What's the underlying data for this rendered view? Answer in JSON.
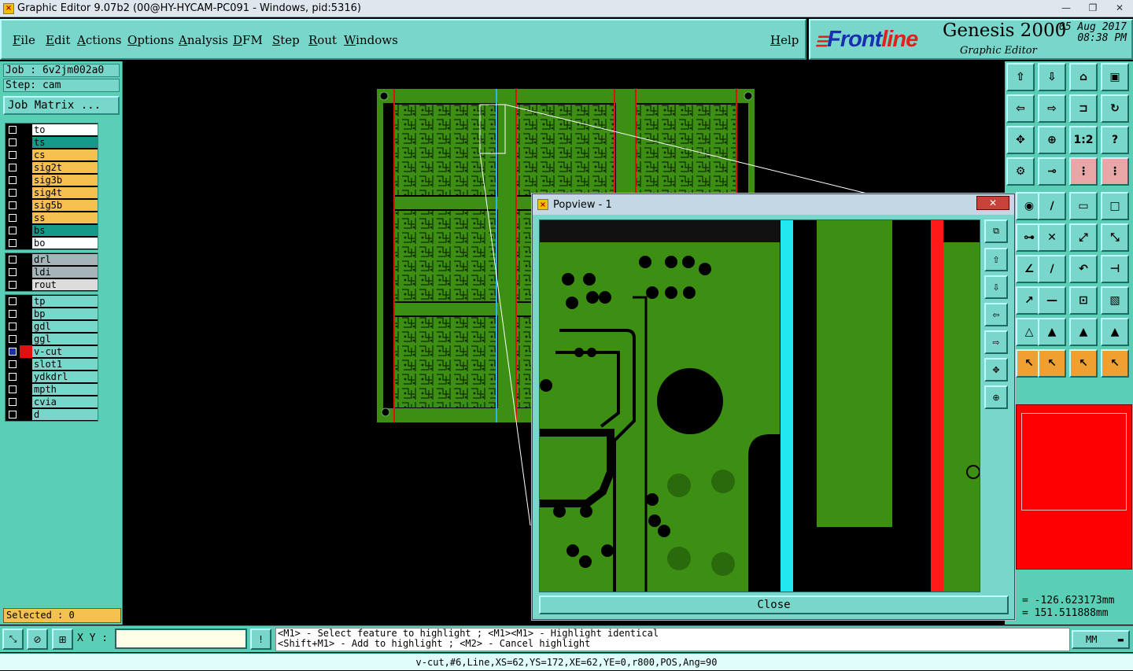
{
  "window": {
    "title": "Graphic Editor 9.07b2 (00@HY-HYCAM-PC091 - Windows, pid:5316)"
  },
  "menu": [
    "File",
    "Edit",
    "Actions",
    "Options",
    "Analysis",
    "DFM",
    "Step",
    "Rout",
    "Windows"
  ],
  "help_label": "Help",
  "brand": {
    "logo_prefix": "Front",
    "logo_suffix": "line",
    "product": "Genesis 2000",
    "subtitle": "Graphic Editor",
    "date": "05 Aug 2017",
    "time": "08:38 PM"
  },
  "job": {
    "job_label": "Job : 6v2jm002a0",
    "step_label": "Step: cam",
    "matrix_button": "Job Matrix ..."
  },
  "layers_group1": [
    {
      "name": "to",
      "color": "#ffffff"
    },
    {
      "name": "ts",
      "color": "#159a8a"
    },
    {
      "name": "cs",
      "color": "#f4c050"
    },
    {
      "name": "sig2t",
      "color": "#f4c050"
    },
    {
      "name": "sig3b",
      "color": "#f4c050"
    },
    {
      "name": "sig4t",
      "color": "#f4c050"
    },
    {
      "name": "sig5b",
      "color": "#f4c050"
    },
    {
      "name": "ss",
      "color": "#f4c050"
    },
    {
      "name": "bs",
      "color": "#159a8a"
    },
    {
      "name": "bo",
      "color": "#ffffff"
    }
  ],
  "layers_group2": [
    {
      "name": "drl",
      "color": "#a4b4b8"
    },
    {
      "name": "ldi",
      "color": "#a4b4b8"
    },
    {
      "name": "rout",
      "color": "#dcdcdc"
    }
  ],
  "layers_group3": [
    {
      "name": "tp",
      "color": "#79d6cb"
    },
    {
      "name": "bp",
      "color": "#79d6cb"
    },
    {
      "name": "gdl",
      "color": "#79d6cb"
    },
    {
      "name": "ggl",
      "color": "#79d6cb"
    },
    {
      "name": "v-cut",
      "color": "#79d6cb",
      "active": true
    },
    {
      "name": "slot1",
      "color": "#79d6cb"
    },
    {
      "name": "ydkdrl",
      "color": "#79d6cb"
    },
    {
      "name": "mpth",
      "color": "#79d6cb"
    },
    {
      "name": "cvia",
      "color": "#79d6cb"
    },
    {
      "name": "d",
      "color": "#79d6cb"
    }
  ],
  "selected_label": "Selected : 0",
  "popview": {
    "title": "Popview - 1",
    "close_label": "Close"
  },
  "coords": {
    "x": "= -126.623173mm",
    "y": "= 151.511888mm"
  },
  "statusbar": {
    "xy_label": "X Y :",
    "xy_value": "",
    "msg_line1": "<M1> - Select feature to highlight ; <M1><M1> - Highlight identical",
    "msg_line2": "<Shift+M1> - Add to highlight ; <M2> - Cancel highlight",
    "units": "MM"
  },
  "feature_info": "v-cut,#6,Line,XS=62,YS=172,XE=62,YE=0,r800,POS,Ang=90",
  "icons": {
    "close": "close-icon",
    "minimize": "minimize-icon",
    "maximize": "maximize-icon"
  }
}
